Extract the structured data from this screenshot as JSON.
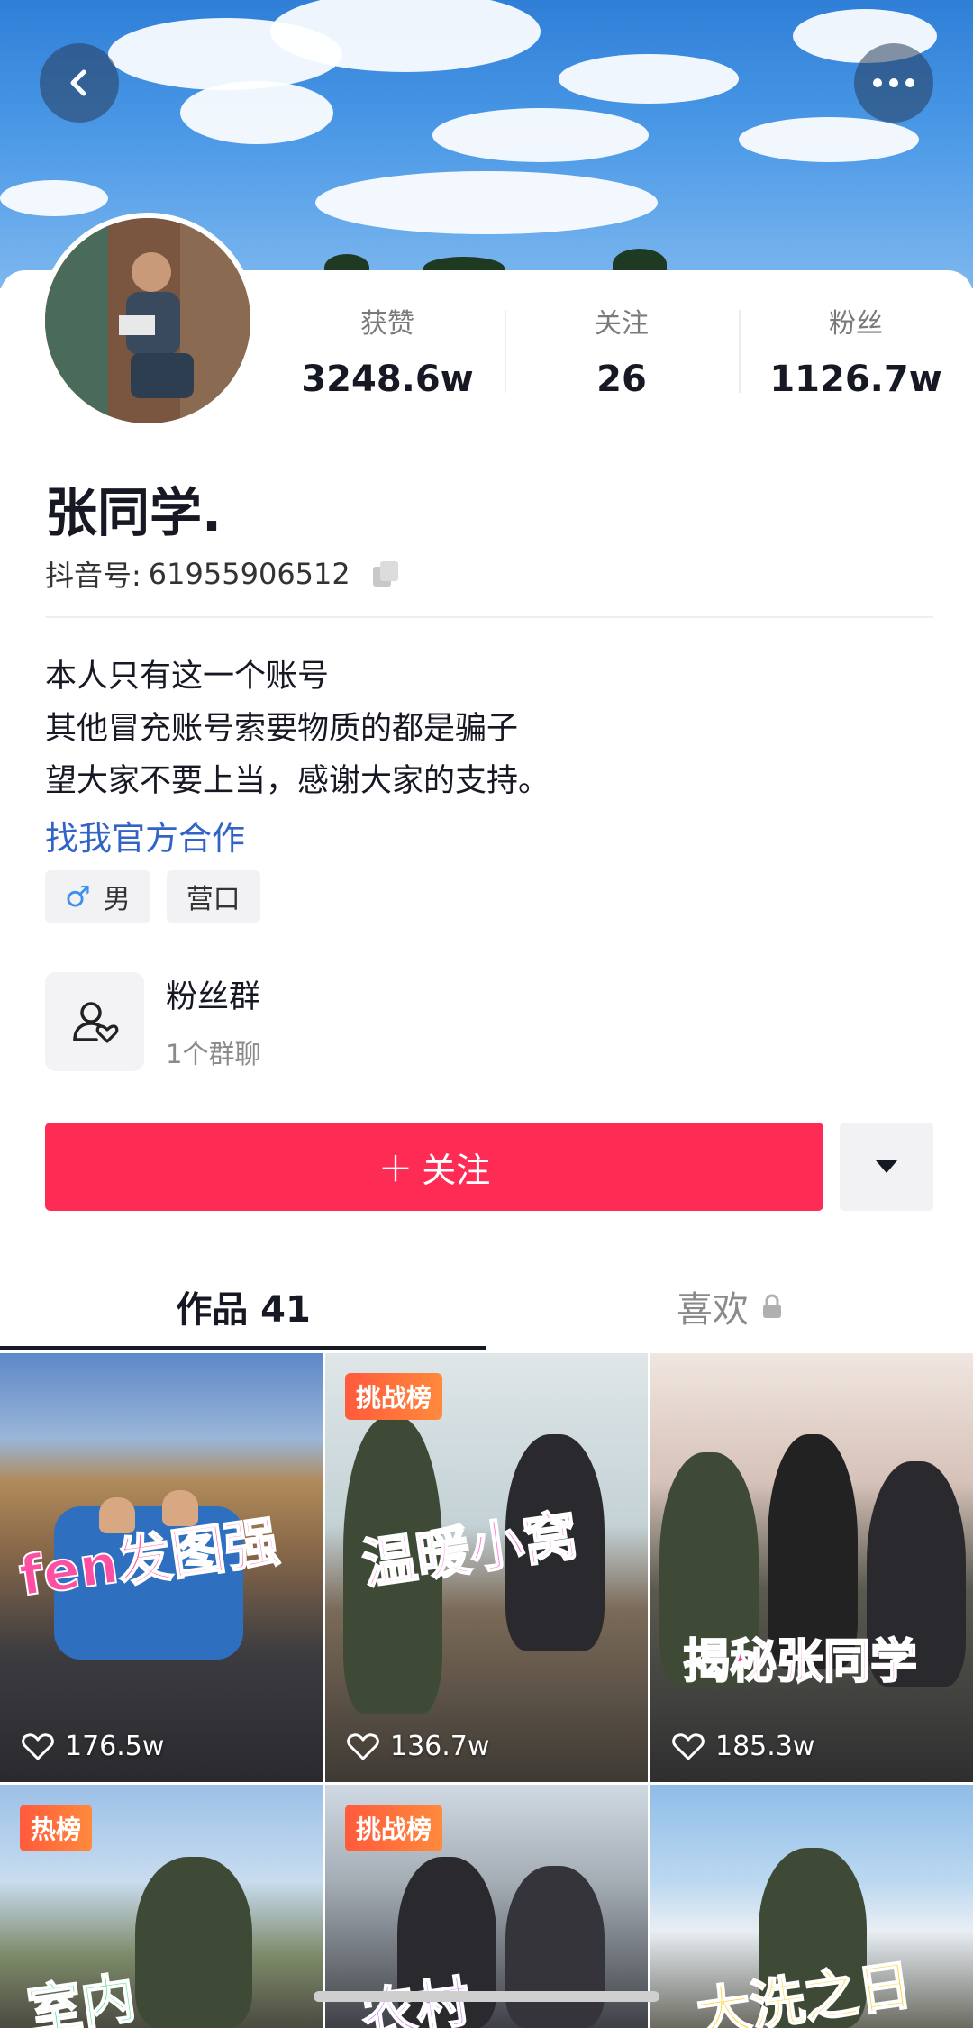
{
  "header": {
    "back_icon": "chevron-left-icon",
    "more_icon": "ellipsis-icon"
  },
  "stats": {
    "likes_label": "获赞",
    "likes_value": "3248.6w",
    "following_label": "关注",
    "following_value": "26",
    "fans_label": "粉丝",
    "fans_value": "1126.7w"
  },
  "profile": {
    "name": "张同学.",
    "douyin_id_label": "抖音号: ",
    "douyin_id": "61955906512",
    "bio": [
      "本人只有这一个账号",
      "其他冒充账号索要物质的都是骗子",
      "望大家不要上当，感谢大家的支持。"
    ],
    "official_link": "找我官方合作",
    "tags": {
      "gender_symbol": "♂",
      "gender": "男",
      "location": "营口"
    }
  },
  "fan_group": {
    "title": "粉丝群",
    "subtitle": "1个群聊"
  },
  "actions": {
    "follow_plus": "+",
    "follow_label": "关注"
  },
  "tabs": {
    "works_label": "作品 41",
    "likes_label": "喜欢"
  },
  "videos": [
    {
      "title": "fen发图强",
      "likes": "176.5w",
      "badge": ""
    },
    {
      "title": "温暖小窝",
      "likes": "136.7w",
      "badge": "挑战榜"
    },
    {
      "title": "揭秘张同学",
      "likes": "185.3w",
      "badge": ""
    },
    {
      "title": "室内",
      "likes": "",
      "badge": "热榜"
    },
    {
      "title": "农村",
      "likes": "",
      "badge": "挑战榜"
    },
    {
      "title": "大洗之日",
      "likes": "",
      "badge": ""
    }
  ],
  "colors": {
    "accent": "#fe2c55",
    "link": "#3264c8"
  }
}
